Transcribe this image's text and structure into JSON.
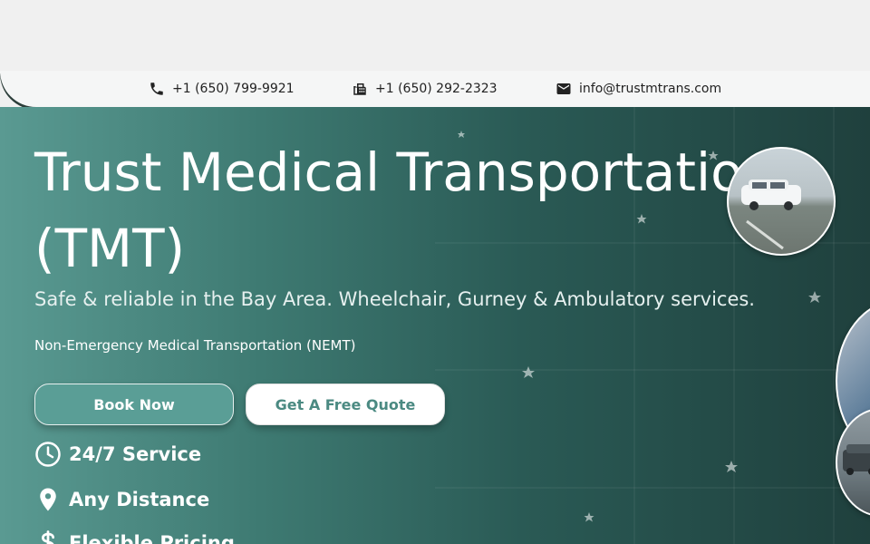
{
  "contact": {
    "phone": "+1 (650) 799-9921",
    "fax": "+1 (650) 292-2323",
    "email": "info@trustmtrans.com"
  },
  "hero": {
    "title": "Trust Medical Transportation (TMT)",
    "subtitle": "Safe & reliable in the Bay Area. Wheelchair, Gurney & Ambulatory services.",
    "tagline": "Non-Emergency Medical Transportation (NEMT)",
    "buttons": {
      "book": "Book Now",
      "quote": "Get A Free Quote"
    },
    "features": [
      {
        "label": "24/7 Service",
        "icon": "clock-icon"
      },
      {
        "label": "Any Distance",
        "icon": "location-pin-icon"
      },
      {
        "label": "Flexible Pricing",
        "icon": "dollar-icon"
      }
    ]
  },
  "colors": {
    "hero_start": "#5a9a92",
    "hero_end": "#1f403d",
    "button_accent": "#5a9e96",
    "quote_text": "#4b8a82"
  }
}
